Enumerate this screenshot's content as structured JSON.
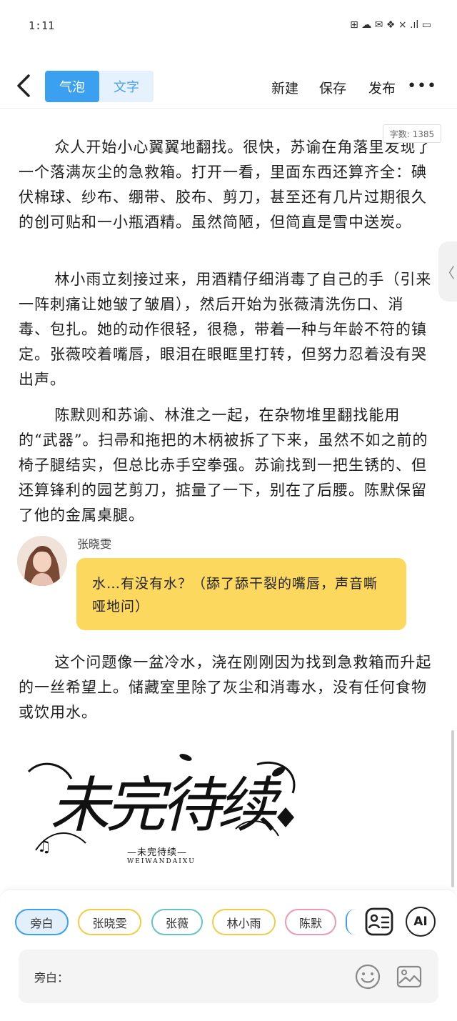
{
  "status_bar": {
    "time": "1:11",
    "icons_text": "⊞ ☁ ✉ ❖ × .ıl ▭"
  },
  "nav": {
    "tabs": [
      {
        "label": "气泡",
        "active": true
      },
      {
        "label": "文字",
        "active": false
      }
    ],
    "actions": {
      "new": "新建",
      "save": "保存",
      "publish": "发布"
    },
    "more": "•••",
    "back_icon": "chevron-left-icon"
  },
  "word_count": "字数: 1385",
  "side_handle": "〈",
  "content": {
    "paragraphs": [
      "众人开始小心翼翼地翻找。很快，苏谕在角落里发现了一个落满灰尘的急救箱。打开一看，里面东西还算齐全：碘伏棉球、纱布、绷带、胶布、剪刀，甚至还有几片过期很久的创可贴和一小瓶酒精。虽然简陋，但简直是雪中送炭。",
      "林小雨立刻接过来，用酒精仔细消毒了自己的手（引来一阵刺痛让她皱了皱眉），然后开始为张薇清洗伤口、消毒、包扎。她的动作很轻，很稳，带着一种与年龄不符的镇定。张薇咬着嘴唇，眼泪在眼眶里打转，但努力忍着没有哭出声。",
      "陈默则和苏谕、林淮之一起，在杂物堆里翻找能用的“武器”。扫帚和拖把的木柄被拆了下来，虽然不如之前的椅子腿结实，但总比赤手空拳强。苏谕找到一把生锈的、但还算锋利的园艺剪刀，掂量了一下，别在了后腰。陈默保留了他的金属桌腿。"
    ],
    "dialogue": {
      "speaker": "张晓雯",
      "text": "水…有没有水？（舔了舔干裂的嘴唇，声音嘶哑地问）"
    },
    "paragraph_after": "这个问题像一盆冷水，浇在刚刚因为找到急救箱而升起的一丝希望上。储藏室里除了灰尘和消毒水，没有任何食物或饮用水。",
    "tbc_image": {
      "title": "未完待续",
      "subtitle": "—未完待续—",
      "pinyin": "WEIWANDAIXU"
    }
  },
  "bottom": {
    "characters": [
      "旁白",
      "张晓雯",
      "张薇",
      "林小雨",
      "陈默"
    ],
    "selected_character": "旁白",
    "ai_label": "AI",
    "input_label": "旁白：",
    "input_value": "",
    "colors": {
      "accent": "#3aa0ef",
      "bubble": "#fcd85e",
      "chip_yellow": "#f1cd47",
      "chip_teal": "#67c2c3",
      "chip_pink": "#ef98b3"
    }
  }
}
